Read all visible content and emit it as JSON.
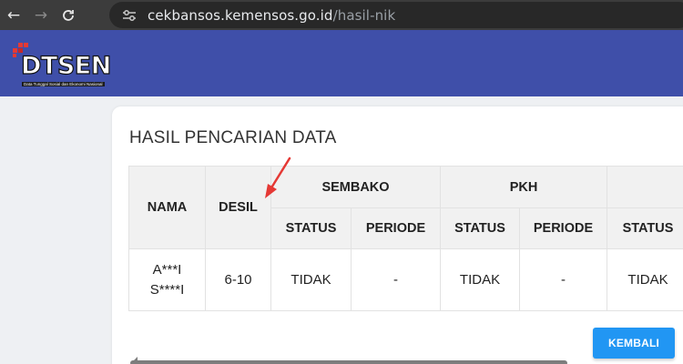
{
  "browser": {
    "back_icon": "arrow-left-icon",
    "forward_icon": "arrow-right-icon",
    "reload_icon": "reload-icon",
    "site_info_icon": "tune-icon",
    "url_host": "cekbansos.kemensos.go.id",
    "url_path": "/hasil-nik"
  },
  "header": {
    "logo_text": "DTSEN",
    "logo_subtitle": "Data Tunggal Sosial dan Ekonomi Nasional",
    "background": "#3f4fa9"
  },
  "main": {
    "title": "HASIL PENCARIAN DATA",
    "table": {
      "headers": {
        "nama": "NAMA",
        "desil": "DESIL",
        "sembako": "SEMBAKO",
        "pkh": "PKH",
        "status": "STATUS",
        "periode": "PERIODE"
      },
      "rows": [
        {
          "nama_line1": "A***I",
          "nama_line2": "S****I",
          "desil": "6-10",
          "sembako_status": "TIDAK",
          "sembako_periode": "-",
          "pkh_status": "TIDAK",
          "pkh_periode": "-",
          "next_status": "TIDAK"
        }
      ]
    },
    "back_button": "KEMBALI",
    "button_color": "#2196f3",
    "annotation_color": "#e53935"
  }
}
